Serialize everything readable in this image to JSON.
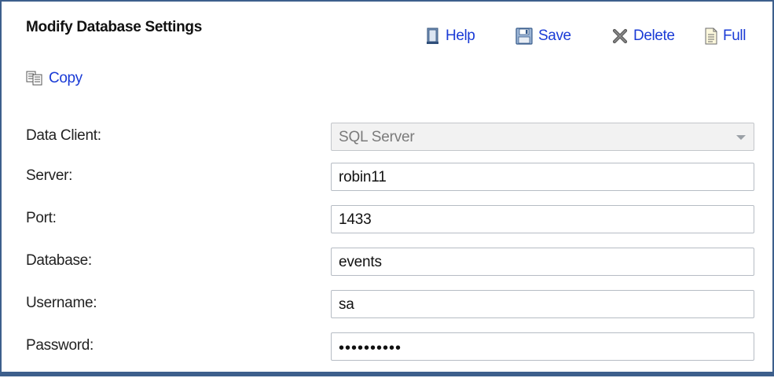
{
  "panel": {
    "title": "Modify Database Settings"
  },
  "toolbar": {
    "help_label": "Help",
    "save_label": "Save",
    "delete_label": "Delete",
    "full_label": "Full",
    "copy_label": "Copy"
  },
  "form": {
    "data_client": {
      "label": "Data Client:",
      "value": "SQL Server"
    },
    "server": {
      "label": "Server:",
      "value": "robin11"
    },
    "port": {
      "label": "Port:",
      "value": "1433"
    },
    "database": {
      "label": "Database:",
      "value": "events"
    },
    "username": {
      "label": "Username:",
      "value": "sa"
    },
    "password": {
      "label": "Password:",
      "value": "••••••••••"
    }
  },
  "colors": {
    "frame_border": "#3d5f8c",
    "link_blue": "#1a3bd6",
    "disabled_bg": "#f2f2f2"
  },
  "icons": [
    "help-book-icon",
    "save-disk-icon",
    "delete-x-icon",
    "full-document-icon",
    "copy-documents-icon",
    "dropdown-caret-icon"
  ]
}
